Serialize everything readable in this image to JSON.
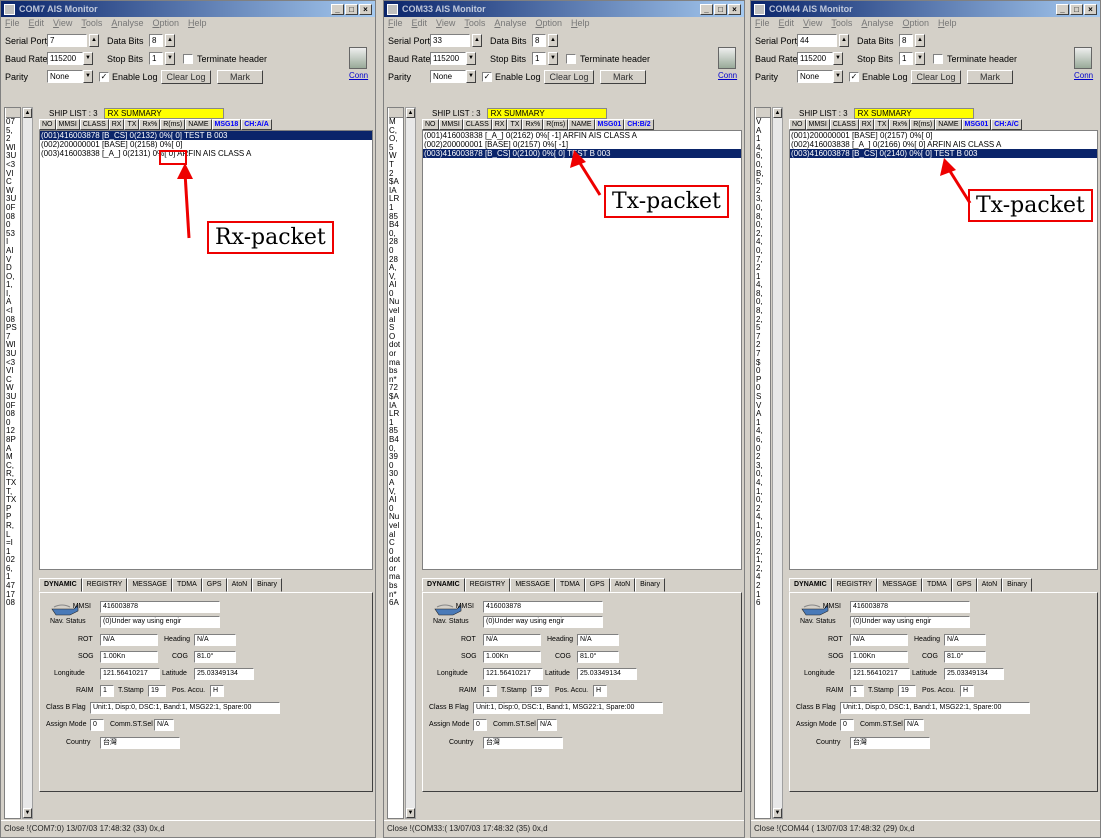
{
  "menu": [
    "File",
    "Edit",
    "View",
    "Tools",
    "Analyse",
    "Option",
    "Help"
  ],
  "labels": {
    "serial_port": "Serial Port",
    "baud_rate": "Baud Rate",
    "parity": "Parity",
    "data_bits": "Data Bits",
    "stop_bits": "Stop Bits",
    "terminate": "Terminate header",
    "enable_log": "Enable Log",
    "clear_log": "Clear Log",
    "mark": "Mark",
    "conn": "Conn",
    "ship_list": "SHIP LIST : 3",
    "rx_summary": "RX SUMMARY"
  },
  "columns": [
    "NO",
    "MMSI",
    "CLASS",
    "RX",
    "TX",
    "Rx%",
    "R(ms)",
    "NAME"
  ],
  "tabs": [
    "DYNAMIC",
    "REGISTRY",
    "MESSAGE",
    "TDMA",
    "GPS",
    "AtoN",
    "Binary"
  ],
  "dynamic": {
    "mmsi_label": "MMSI",
    "mmsi": "416003878",
    "nav_label": "Nav. Status",
    "nav": "(0)Under way using engir",
    "rot_label": "ROT",
    "rot": "N/A",
    "heading_label": "Heading",
    "heading": "N/A",
    "sog_label": "SOG",
    "sog": "1.00Kn",
    "cog_label": "COG",
    "cog": "81.0°",
    "lon_label": "Longitude",
    "lon": "121.56410217",
    "lat_label": "Latitude",
    "lat": "25.03349134",
    "raim_label": "RAIM",
    "raim": "1",
    "tstamp_label": "T.Stamp",
    "tstamp": "19",
    "posacc_label": "Pos. Accu.",
    "posacc": "H",
    "classb_label": "Class B Flag",
    "classb": "Unit:1, Disp:0, DSC:1, Band:1, MSG22:1, Spare:00",
    "assign_label": "Assign Mode",
    "assign": "0",
    "commst_label": "Comm.ST.Sel",
    "commst": "N/A",
    "country_label": "Country",
    "country": "台灣"
  },
  "windows": [
    {
      "title": "COM7 AIS Monitor",
      "port": "7",
      "baud": "115200",
      "parity": "None",
      "data_bits": "8",
      "stop_bits": "1",
      "col_extra1": "MSG18",
      "col_extra2": "CH:A/A",
      "ships": [
        "(001)416003878 [B_CS] 0(2132) 0%[ 0] TEST B 003",
        "(002)200000001 [BASE] 0(2158) 0%[ 0]",
        "(003)416003838 [_A_] 0(2131) 0%[ 0] ARFIN AIS CLASS A"
      ],
      "sel": 0,
      "vlist": [
        "07",
        "5,",
        "2",
        "WI",
        "3U",
        "<3",
        "VI",
        "C",
        "W",
        "3U",
        "0F",
        "08",
        "0",
        "53",
        "I",
        "AI",
        "V",
        "D",
        "O,",
        "1,",
        "I,",
        "A",
        "<I",
        "08",
        "PS",
        "7",
        "WI",
        "3U",
        "<3",
        "VI",
        "C",
        "W",
        "3U",
        "0F",
        "08",
        "0",
        "12",
        "8P",
        "A",
        "M",
        "C,",
        "R,",
        "TX",
        "T,",
        "TX",
        "P",
        "P",
        "R,",
        "L",
        "=I",
        "1",
        "02",
        "6,",
        "1",
        "47",
        "17",
        "08"
      ],
      "status": "Close !(COM7:0) 13/07/03 17:48:32 (33) 0x,d"
    },
    {
      "title": "COM33 AIS Monitor",
      "port": "33",
      "baud": "115200",
      "parity": "None",
      "data_bits": "8",
      "stop_bits": "1",
      "col_extra1": "MSG01",
      "col_extra2": "CH:B/2",
      "ships": [
        "(001)416003838 [_A_] 0(2162) 0%[ -1] ARFIN AIS CLASS A",
        "(002)200000001 [BASE] 0(2157) 0%[ -1]",
        "(003)416003878 [B_CS] 0(2100) 0%[ 0] TEST B 003"
      ],
      "sel": 2,
      "vlist": [
        "M",
        "C,",
        "O,",
        "5",
        "W",
        "T",
        "2",
        "$A",
        "IA",
        "LR",
        "1",
        "85",
        "B4",
        "0,",
        "28",
        "0",
        "28",
        "A,",
        "V,",
        "AI",
        "0",
        "Nu",
        "vel",
        "al",
        "S",
        "O",
        "dot",
        "or",
        "ma",
        "bs",
        "n*",
        "72",
        "$A",
        "IA",
        "LR",
        "1",
        "85",
        "B4",
        "0,",
        "39",
        "0",
        "30",
        "A",
        "V,",
        "AI",
        "0",
        "Nu",
        "vel",
        "al",
        "C",
        "0",
        "dot",
        "or",
        "ma",
        "bs",
        "n*",
        "6A"
      ],
      "status": "Close !(COM33:( 13/07/03 17:48:32 (35) 0x,d"
    },
    {
      "title": "COM44 AIS Monitor",
      "port": "44",
      "baud": "115200",
      "parity": "None",
      "data_bits": "8",
      "stop_bits": "1",
      "col_extra1": "MSG01",
      "col_extra2": "CH:A/C",
      "ships": [
        "(001)200000001 [BASE] 0(2157) 0%[ 0]",
        "(002)416003838 [_A_] 0(2166) 0%[ 0] ARFIN AIS CLASS A",
        "(003)416003878 [B_CS] 0(2140) 0%[ 0] TEST B 003"
      ],
      "sel": 2,
      "vlist": [
        "V",
        "A",
        "1",
        "4,",
        "6,",
        "0,",
        "B,",
        "5,",
        "2",
        "3,",
        "0,",
        "8,",
        "0,",
        "2,",
        "4,",
        "0,",
        "7,",
        "2",
        "1",
        "4,",
        "8,",
        "0,",
        "8,",
        "2,",
        "5",
        "7",
        "2",
        "7",
        "$",
        "0",
        "P",
        "0",
        "S",
        "V",
        "A",
        "1",
        "4,",
        "6,",
        "0",
        "2",
        "3,",
        "0,",
        "4,",
        "1,",
        "0,",
        "2",
        "4,",
        "1,",
        "0,",
        "2",
        "2,",
        "1,",
        "2,",
        "4",
        "2",
        "1",
        "6"
      ],
      "status": "Close !(COM44 ( 13/07/03 17:48:32 (29) 0x,d"
    }
  ],
  "annotations": {
    "rx": "Rx-packet",
    "tx1": "Tx-packet",
    "tx2": "Tx-packet",
    "highlight": "2132"
  }
}
